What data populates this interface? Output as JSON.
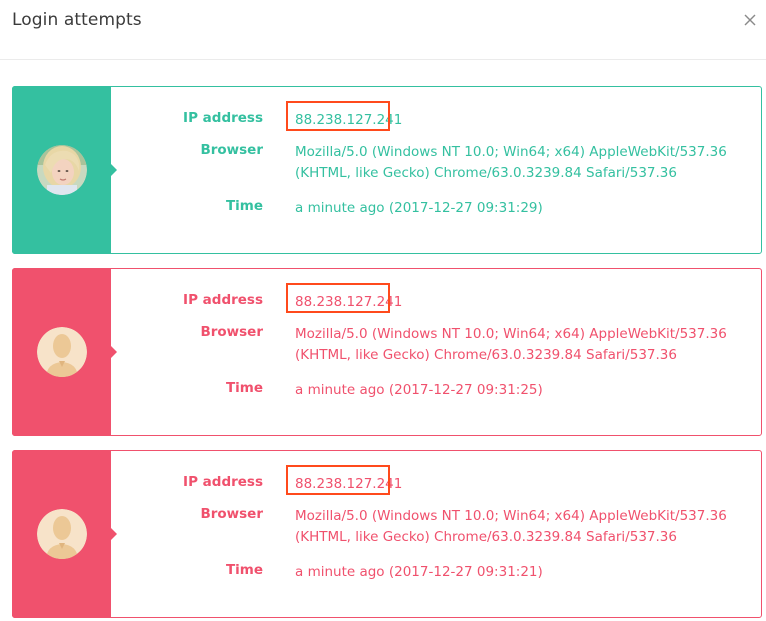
{
  "dialog": {
    "title": "Login attempts",
    "close_icon": "close-icon"
  },
  "colors": {
    "success": "#34c0a0",
    "failure": "#f0516d",
    "highlight_box": "#ff4a1c"
  },
  "labels": {
    "ip": "IP address",
    "browser": "Browser",
    "time": "Time"
  },
  "attempts": [
    {
      "status": "success",
      "avatar": "user-photo-avatar",
      "ip": "88.238.127.241",
      "browser_line1": "Mozilla/5.0 (Windows NT 10.0; Win64; x64) AppleWebKit/537.36",
      "browser_line2": "(KHTML, like Gecko) Chrome/63.0.3239.84 Safari/537.36",
      "time": "a minute ago (2017-12-27 09:31:29)"
    },
    {
      "status": "failure",
      "avatar": "default-user-avatar",
      "ip": "88.238.127.241",
      "browser_line1": "Mozilla/5.0 (Windows NT 10.0; Win64; x64) AppleWebKit/537.36",
      "browser_line2": "(KHTML, like Gecko) Chrome/63.0.3239.84 Safari/537.36",
      "time": "a minute ago (2017-12-27 09:31:25)"
    },
    {
      "status": "failure",
      "avatar": "default-user-avatar",
      "ip": "88.238.127.241",
      "browser_line1": "Mozilla/5.0 (Windows NT 10.0; Win64; x64) AppleWebKit/537.36",
      "browser_line2": "(KHTML, like Gecko) Chrome/63.0.3239.84 Safari/537.36",
      "time": "a minute ago (2017-12-27 09:31:21)"
    }
  ]
}
